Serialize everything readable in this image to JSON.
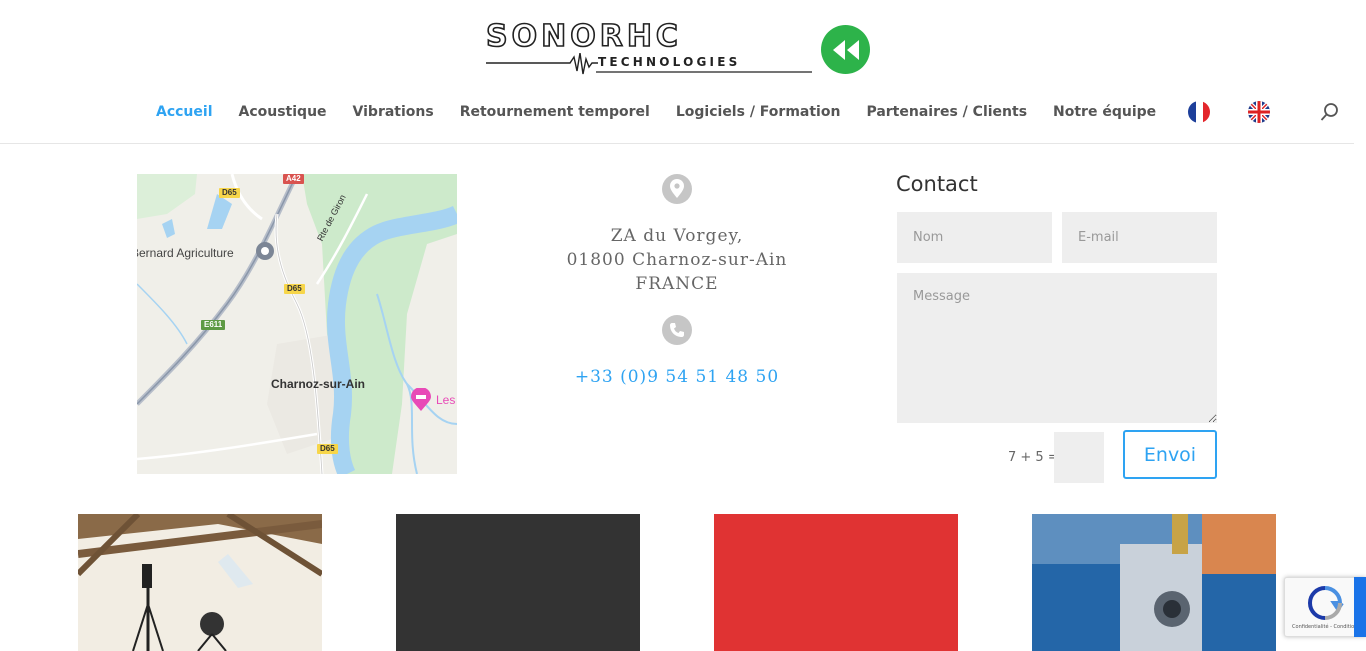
{
  "header": {
    "logo": {
      "word": "SONORHC",
      "subtitle": "TECHNOLOGIES",
      "button_icon": "rewind-icon",
      "button_color": "#2db34a"
    },
    "nav": {
      "items": [
        {
          "label": "Accueil",
          "active": true
        },
        {
          "label": "Acoustique",
          "active": false
        },
        {
          "label": "Vibrations",
          "active": false
        },
        {
          "label": "Retournement temporel",
          "active": false
        },
        {
          "label": "Logiciels / Formation",
          "active": false
        },
        {
          "label": "Partenaires / Clients",
          "active": false
        },
        {
          "label": "Notre équipe",
          "active": false
        }
      ],
      "flags": [
        "french-flag-icon",
        "uk-flag-icon"
      ],
      "search_icon": "search-icon",
      "accent_color": "#2ea3f2"
    }
  },
  "map": {
    "place_label": "Charnoz-sur-Ain",
    "poi_label": "Bernard Agriculture",
    "poi_right_label": "Les",
    "road_label": "Rte de Giron",
    "shields": [
      "D65",
      "A42",
      "D65",
      "E611",
      "D65"
    ]
  },
  "address": {
    "location_icon": "map-pin-icon",
    "line1": "ZA du Vorgey,",
    "line2": "01800 Charnoz-sur-Ain",
    "line3": "FRANCE",
    "phone_icon": "phone-icon",
    "phone": "+33 (0)9 54 51 48 50"
  },
  "contact": {
    "title": "Contact",
    "name_placeholder": "Nom",
    "email_placeholder": "E-mail",
    "message_placeholder": "Message",
    "captcha_question": "7 + 5 =",
    "captcha_value": "",
    "send_label": "Envoi"
  },
  "tiles": [
    {
      "name": "acoustic-photo",
      "color": "#e9e2d6"
    },
    {
      "name": "dark-tile",
      "color": "#333333"
    },
    {
      "name": "red-tile",
      "color": "#e03333"
    },
    {
      "name": "vibration-photo",
      "color": "#1f5e9e"
    }
  ],
  "recaptcha": {
    "icon": "recaptcha-icon",
    "text": "Confidentialité - Conditions"
  }
}
